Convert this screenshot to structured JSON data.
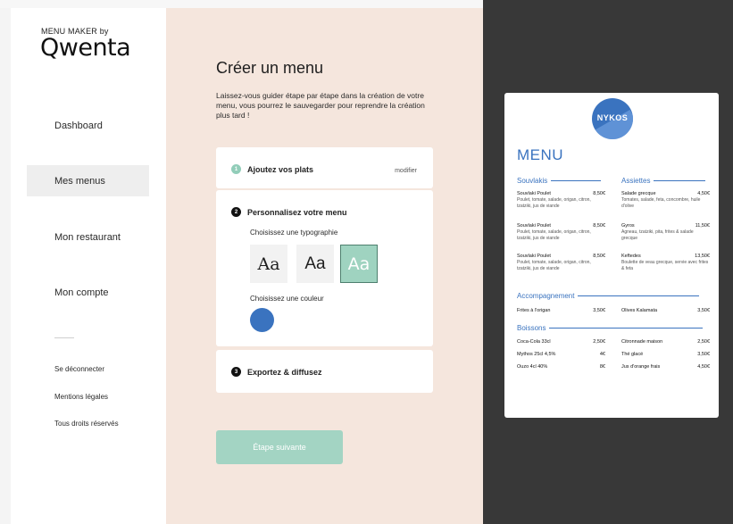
{
  "brand": {
    "small": "MENU MAKER by",
    "logo": "Qwenta"
  },
  "sidebar": {
    "items": [
      {
        "label": "Dashboard"
      },
      {
        "label": "Mes menus"
      },
      {
        "label": "Mon restaurant"
      },
      {
        "label": "Mon compte"
      }
    ],
    "footer": [
      "Se déconnecter",
      "Mentions légales",
      "Tous droits réservés"
    ]
  },
  "main": {
    "title": "Créer un menu",
    "intro": "Laissez-vous guider étape par étape dans la création de votre menu, vous pourrez le sauvegarder pour reprendre la création plus tard !",
    "steps": [
      {
        "num": "1",
        "label": "Ajoutez vos plats",
        "action": "modifier"
      },
      {
        "num": "2",
        "label": "Personnalisez votre menu"
      },
      {
        "num": "3",
        "label": "Exportez & diffusez"
      }
    ],
    "typo_label": "Choisissez une typographie",
    "fonts": [
      "Aa",
      "Aa",
      "Aa"
    ],
    "color_label": "Choisissez une couleur",
    "selected_color": "#3a73bf",
    "next_button": "Étape suivante"
  },
  "preview": {
    "logo_text": "NYKOS",
    "menu_title": "MENU",
    "sections": {
      "souvlakis": "Souvlakis",
      "assiettes": "Assiettes",
      "accompagnement": "Accompagnement",
      "boissons": "Boissons"
    },
    "souvlakis_items": [
      {
        "name": "Souvlaki Poulet",
        "price": "8,50€",
        "desc": "Poulet, tomate, salade, origan, citron, tzatziki, jus de viande"
      },
      {
        "name": "Souvlaki Poulet",
        "price": "8,50€",
        "desc": "Poulet, tomate, salade, origan, citron, tzatziki, jus de viande"
      },
      {
        "name": "Souvlaki Poulet",
        "price": "8,50€",
        "desc": "Poulet, tomate, salade, origan, citron, tzatziki, jus de viande"
      }
    ],
    "assiettes_items": [
      {
        "name": "Salade grecque",
        "price": "4,50€",
        "desc": "Tomates, salade, feta, concombre, huile d'olive"
      },
      {
        "name": "Gyros",
        "price": "11,50€",
        "desc": "Agneau, tzatziki, pita, frites & salade grecque"
      },
      {
        "name": "Keftedes",
        "price": "13,50€",
        "desc": "Boulette de veau grecque, servie avec frites & feta"
      }
    ],
    "accompagnement_items": [
      {
        "name": "Frites à l'origan",
        "price": "3,50€"
      },
      {
        "name": "Olives Kalamata",
        "price": "3,50€"
      }
    ],
    "boissons_items": [
      {
        "name": "Coca-Cola 33cl",
        "price": "2,50€"
      },
      {
        "name": "Citronnade maison",
        "price": "2,50€"
      },
      {
        "name": "Mythos 25cl 4,5%",
        "price": "4€"
      },
      {
        "name": "Thé glacé",
        "price": "3,50€"
      },
      {
        "name": "Ouzo 4cl 40%",
        "price": "8€"
      },
      {
        "name": "Jus d'orange frais",
        "price": "4,50€"
      }
    ]
  }
}
